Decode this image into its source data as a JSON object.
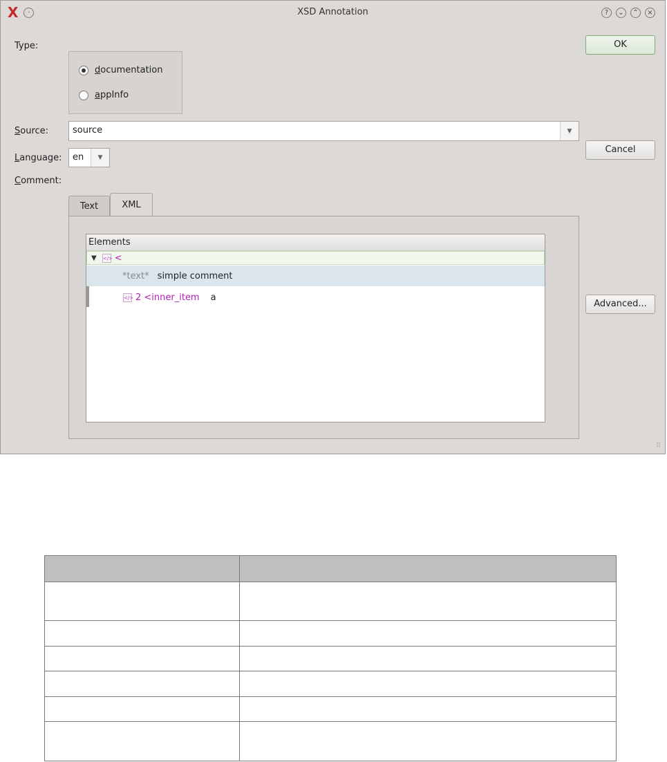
{
  "window": {
    "title": "XSD Annotation",
    "title_controls": [
      "help-icon",
      "minimize-icon",
      "maximize-icon",
      "close-icon"
    ]
  },
  "labels": {
    "type": "Type:",
    "source_pre": "S",
    "source_post": "ource:",
    "language_pre": "L",
    "language_post": "anguage:",
    "comment_pre": "C",
    "comment_post": "omment:"
  },
  "type_options": [
    {
      "pre": "d",
      "post": "ocumentation",
      "selected": true
    },
    {
      "pre": "a",
      "post": "ppInfo",
      "selected": false
    }
  ],
  "source": {
    "value": "source"
  },
  "language": {
    "value": "en"
  },
  "tabs": [
    {
      "label": "Text",
      "active": false
    },
    {
      "label": "XML",
      "active": true
    }
  ],
  "tree": {
    "header": "Elements",
    "root": {
      "tag": "<"
    },
    "rows": [
      {
        "name": "*text*",
        "value": "simple comment"
      },
      {
        "name": "2 <inner_item",
        "value": "a"
      }
    ]
  },
  "buttons": {
    "ok": "OK",
    "cancel": "Cancel",
    "advanced": "Advanced..."
  },
  "colors": {
    "window_bg": "#dcd9d6",
    "tag_purple": "#b21eb2",
    "selected_row": "#dbe6ec"
  }
}
